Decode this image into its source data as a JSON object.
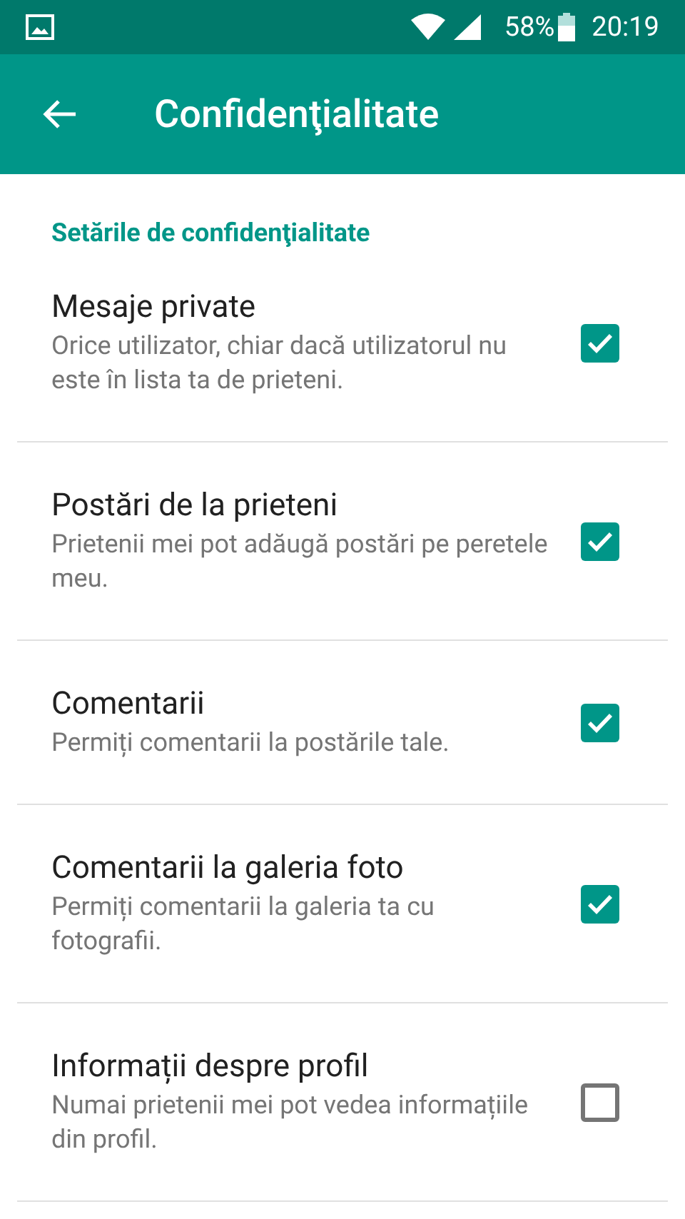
{
  "status_bar": {
    "battery": "58%",
    "time": "20:19"
  },
  "toolbar": {
    "title": "Confidenţialitate"
  },
  "section": {
    "title": "Setările de confidenţialitate"
  },
  "settings": [
    {
      "title": "Mesaje private",
      "description": "Orice utilizator, chiar dacă utilizatorul nu este în lista ta de prieteni.",
      "checked": true
    },
    {
      "title": "Postări de la prieteni",
      "description": "Prietenii mei pot adăugă postări pe peretele meu.",
      "checked": true
    },
    {
      "title": "Comentarii",
      "description": "Permiți comentarii la postările tale.",
      "checked": true
    },
    {
      "title": "Comentarii la galeria foto",
      "description": "Permiți comentarii la galeria ta cu fotografii.",
      "checked": true
    },
    {
      "title": "Informații despre profil",
      "description": "Numai prietenii mei pot vedea informațiile din profil.",
      "checked": false
    }
  ]
}
